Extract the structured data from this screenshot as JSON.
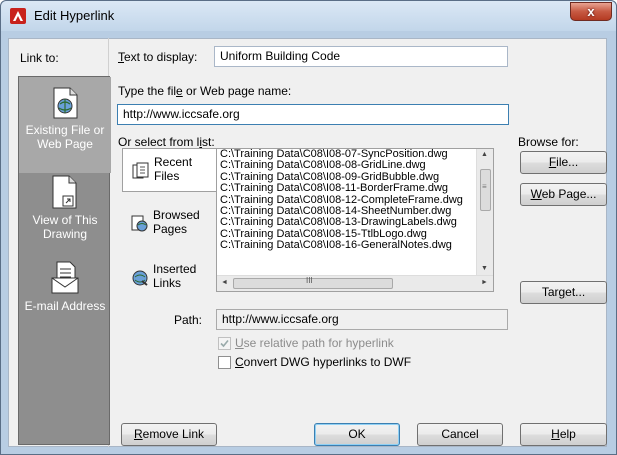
{
  "window": {
    "title": "Edit Hyperlink",
    "close_glyph": "x"
  },
  "link_to": {
    "label": "Link to:",
    "items": [
      {
        "label": "Existing File or Web Page",
        "icon": "globe-page-icon",
        "active": true
      },
      {
        "label": "View of This Drawing",
        "icon": "drawing-view-icon",
        "active": false
      },
      {
        "label": "E-mail Address",
        "icon": "email-icon",
        "active": false
      }
    ]
  },
  "text_to_display": {
    "label_u": "T",
    "label_rest": "ext to display:",
    "value": "Uniform Building Code"
  },
  "file_name": {
    "label_pre": "Type the fil",
    "label_u": "e",
    "label_post": " or Web page name:",
    "value": "http://www.iccsafe.org"
  },
  "select_list": {
    "label_pre": "Or select from l",
    "label_u": "i",
    "label_post": "st:",
    "tabs": [
      {
        "label": "Recent\nFiles",
        "icon": "recent-files-icon",
        "active": true
      },
      {
        "label": "Browsed\nPages",
        "icon": "browsed-pages-icon",
        "active": false
      },
      {
        "label": "Inserted\nLinks",
        "icon": "inserted-links-icon",
        "active": false
      }
    ],
    "items": [
      "C:\\Training Data\\C08\\I08-07-SyncPosition.dwg",
      "C:\\Training Data\\C08\\I08-08-GridLine.dwg",
      "C:\\Training Data\\C08\\I08-09-GridBubble.dwg",
      "C:\\Training Data\\C08\\I08-11-BorderFrame.dwg",
      "C:\\Training Data\\C08\\I08-12-CompleteFrame.dwg",
      "C:\\Training Data\\C08\\I08-14-SheetNumber.dwg",
      "C:\\Training Data\\C08\\I08-13-DrawingLabels.dwg",
      "C:\\Training Data\\C08\\I08-15-TtlbLogo.dwg",
      "C:\\Training Data\\C08\\I08-16-GeneralNotes.dwg"
    ],
    "scroll_up": "▲",
    "scroll_down": "▼",
    "scroll_left": "◄",
    "scroll_right": "►",
    "hscroll_grip": "III",
    "vscroll_grip": "≡"
  },
  "browse": {
    "label": "Browse for:",
    "file_button": {
      "u": "F",
      "rest": "ile..."
    },
    "web_button": {
      "u": "W",
      "rest": "eb Page..."
    },
    "target_button": {
      "pre": "Tar",
      "u": "g",
      "post": "et..."
    }
  },
  "path": {
    "label": "Path:",
    "value": "http://www.iccsafe.org"
  },
  "options": {
    "relative": {
      "u": "U",
      "rest": "se relative path for hyperlink",
      "checked": true,
      "enabled": false
    },
    "convert": {
      "u": "C",
      "rest": "onvert DWG hyperlinks to DWF",
      "checked": false,
      "enabled": true
    }
  },
  "buttons": {
    "remove": {
      "u": "R",
      "rest": "emove Link"
    },
    "ok": "OK",
    "cancel": "Cancel",
    "help": {
      "u": "H",
      "rest": "elp"
    }
  },
  "colors": {
    "accent": "#3c7fb1",
    "close_button": "#c75a43",
    "nav_panel": "#8e8e8e"
  }
}
